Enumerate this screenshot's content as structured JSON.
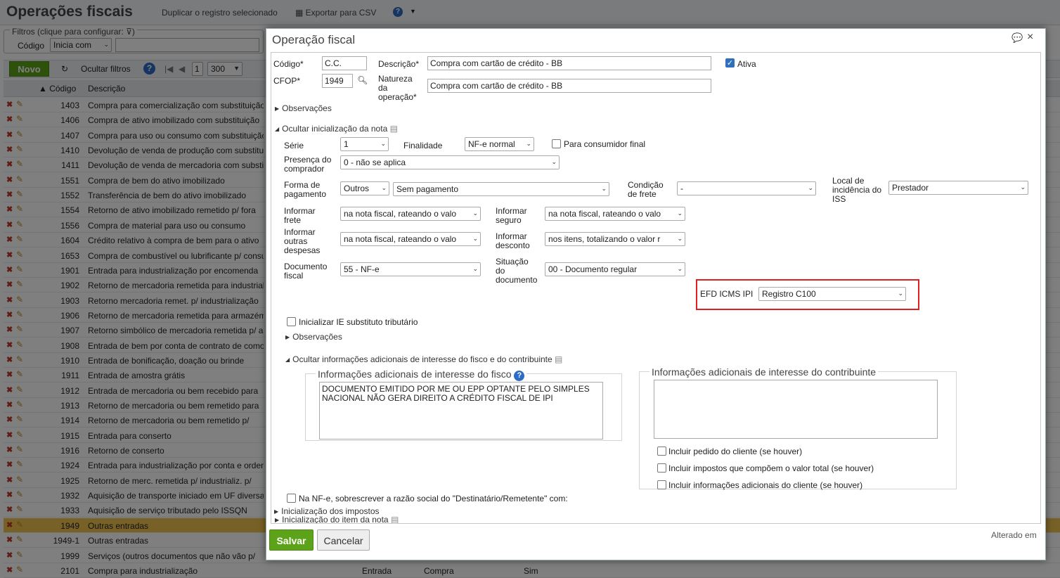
{
  "app": {
    "title": "Operações fiscais",
    "duplicate": "Duplicar o registro selecionado",
    "export": "Exportar para CSV",
    "filters_legend": "Filtros (clique para configurar:",
    "filter_field_label": "Código",
    "filter_operator": "Inicia com",
    "new_button": "Novo",
    "hide_filters": "Ocultar filtros",
    "page": "1",
    "page_size": "300",
    "col_code": "Código",
    "col_desc": "Descrição"
  },
  "rows": [
    {
      "code": "1403",
      "desc": "Compra para comercialização com substituição"
    },
    {
      "code": "1406",
      "desc": "Compra de ativo imobilizado com substituição"
    },
    {
      "code": "1407",
      "desc": "Compra para uso ou consumo com substituição"
    },
    {
      "code": "1410",
      "desc": "Devolução de venda de produção com substituição"
    },
    {
      "code": "1411",
      "desc": "Devolução de venda de mercadoria com substituição"
    },
    {
      "code": "1551",
      "desc": "Compra de bem do ativo imobilizado"
    },
    {
      "code": "1552",
      "desc": "Transferência de bem do ativo imobilizado"
    },
    {
      "code": "1554",
      "desc": "Retorno de ativo imobilizado remetido p/ fora"
    },
    {
      "code": "1556",
      "desc": "Compra de material para uso ou consumo"
    },
    {
      "code": "1604",
      "desc": "Crédito relativo à compra de bem para o ativo"
    },
    {
      "code": "1653",
      "desc": "Compra de combustível ou lubrificante p/ consumo"
    },
    {
      "code": "1901",
      "desc": "Entrada para industrialização por encomenda"
    },
    {
      "code": "1902",
      "desc": "Retorno de mercadoria remetida para industrialização"
    },
    {
      "code": "1903",
      "desc": "Retorno mercadoria remet. p/ industrialização"
    },
    {
      "code": "1906",
      "desc": "Retorno de mercadoria remetida para armazém"
    },
    {
      "code": "1907",
      "desc": "Retorno simbólico de mercadoria remetida p/ armazém"
    },
    {
      "code": "1908",
      "desc": "Entrada de bem por conta de contrato de comodato"
    },
    {
      "code": "1910",
      "desc": "Entrada de bonificação, doação ou brinde"
    },
    {
      "code": "1911",
      "desc": "Entrada de amostra grátis"
    },
    {
      "code": "1912",
      "desc": "Entrada de mercadoria ou bem recebido para"
    },
    {
      "code": "1913",
      "desc": "Retorno de mercadoria ou bem remetido para"
    },
    {
      "code": "1914",
      "desc": "Retorno de mercadoria ou bem remetido p/"
    },
    {
      "code": "1915",
      "desc": "Entrada para conserto"
    },
    {
      "code": "1916",
      "desc": "Retorno de conserto"
    },
    {
      "code": "1924",
      "desc": "Entrada para industrialização por conta e ordem"
    },
    {
      "code": "1925",
      "desc": "Retorno de merc. remetida p/ industrializ. p/"
    },
    {
      "code": "1932",
      "desc": "Aquisição de transporte iniciado em UF diversa"
    },
    {
      "code": "1933",
      "desc": "Aquisição de serviço tributado pelo ISSQN"
    },
    {
      "code": "1949",
      "desc": "Outras entradas"
    },
    {
      "code": "1949-1",
      "desc": "Outras entradas"
    },
    {
      "code": "1999",
      "desc": "Serviços (outros documentos que não vão p/"
    },
    {
      "code": "2101",
      "desc": "Compra para industrialização"
    }
  ],
  "last_row_extra": {
    "type": "Entrada",
    "kind": "Compra",
    "flag": "Sim"
  },
  "dialog": {
    "title": "Operação fiscal",
    "codigo_label": "Código*",
    "codigo_value": "C.C.",
    "descricao_label": "Descrição*",
    "descricao_value": "Compra com cartão de crédito - BB",
    "ativa_label": "Ativa",
    "cfop_label": "CFOP*",
    "cfop_value": "1949",
    "natureza_label": "Natureza\nda\noperação*",
    "natureza_value": "Compra com cartão de crédito - BB",
    "observacoes": "Observações",
    "ocultar_init": "Ocultar inicialização da nota",
    "serie_label": "Série",
    "serie_value": "1",
    "finalidade_label": "Finalidade",
    "finalidade_value": "NF-e normal",
    "consumidor_final": "Para consumidor final",
    "presenca_label": "Presença do\ncomprador",
    "presenca_value": "0 - não se aplica",
    "forma_label": "Forma de\npagamento",
    "forma_value1": "Outros",
    "forma_value2": "Sem pagamento",
    "condicao_label": "Condição\nde frete",
    "condicao_value": "-",
    "local_iss_label": "Local de\nincidência do\nISS",
    "local_iss_value": "Prestador",
    "frete_label": "Informar\nfrete",
    "frete_value": "na nota fiscal, rateando o valo",
    "seguro_label": "Informar\nseguro",
    "seguro_value": "na nota fiscal, rateando o valo",
    "outras_label": "Informar\noutras\ndespesas",
    "outras_value": "na nota fiscal, rateando o valo",
    "desconto_label": "Informar\ndesconto",
    "desconto_value": "nos itens, totalizando o valor r",
    "documento_label": "Documento\nfiscal",
    "documento_value": "55 - NF-e",
    "situacao_label": "Situação\ndo\ndocumento",
    "situacao_value": "00 - Documento regular",
    "efd_label": "EFD ICMS IPI",
    "efd_value": "Registro C100",
    "ie_subst": "Inicializar IE substituto tributário",
    "observacoes2": "Observações",
    "ocultar_info": "Ocultar informações adicionais de interesse do fisco e do contribuinte",
    "fisco_legend": "Informações adicionais de interesse do fisco",
    "fisco_text": "DOCUMENTO EMITIDO POR ME OU EPP OPTANTE PELO SIMPLES NACIONAL NÃO GERA DIREITO A CRÉDITO FISCAL DE IPI",
    "contrib_legend": "Informações adicionais de interesse do contribuinte",
    "incluir_pedido": "Incluir pedido do cliente (se houver)",
    "incluir_impostos": "Incluir impostos que compõem o valor total (se houver)",
    "incluir_info": "Incluir informações adicionais do cliente (se houver)",
    "sobrescrever": "Na NF-e, sobrescrever a razão social do \"Destinatário/Remetente\" com:",
    "init_item": "Inicialização do item da nota",
    "init_impostos": "Inicialização dos impostos",
    "salvar": "Salvar",
    "cancelar": "Cancelar",
    "alterado": "Alterado em"
  },
  "colors": {
    "accent_green": "#5da319",
    "highlight_red": "#e02020",
    "selected_row": "#f0c24d",
    "check_blue": "#2f6fbd"
  }
}
